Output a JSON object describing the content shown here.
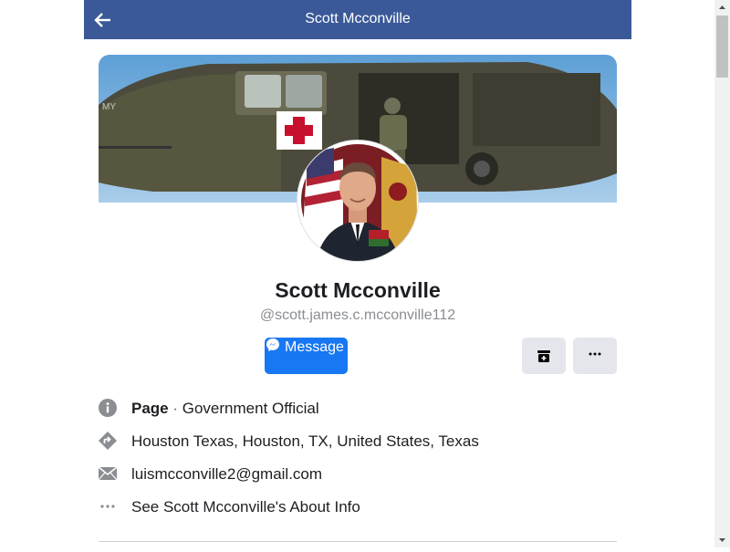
{
  "header": {
    "title": "Scott Mcconville",
    "back_icon": "arrow-left-icon",
    "color": "#3b5998"
  },
  "profile": {
    "name": "Scott Mcconville",
    "handle": "@scott.james.c.mcconville112",
    "cover_icon": "helicopter-cover-photo",
    "avatar_icon": "profile-photo"
  },
  "actions": {
    "message_label": "Message",
    "message_icon": "messenger-icon",
    "archive_icon": "archive-plus-icon",
    "more_icon": "more-dots-icon",
    "accent": "#1877f2"
  },
  "info": {
    "page_label": "Page",
    "page_sep": " · ",
    "page_category": "Government Official",
    "location": "Houston Texas, Houston, TX, United States, Texas",
    "email": "luismcconville2@gmail.com",
    "about": "See Scott Mcconville's About Info"
  }
}
